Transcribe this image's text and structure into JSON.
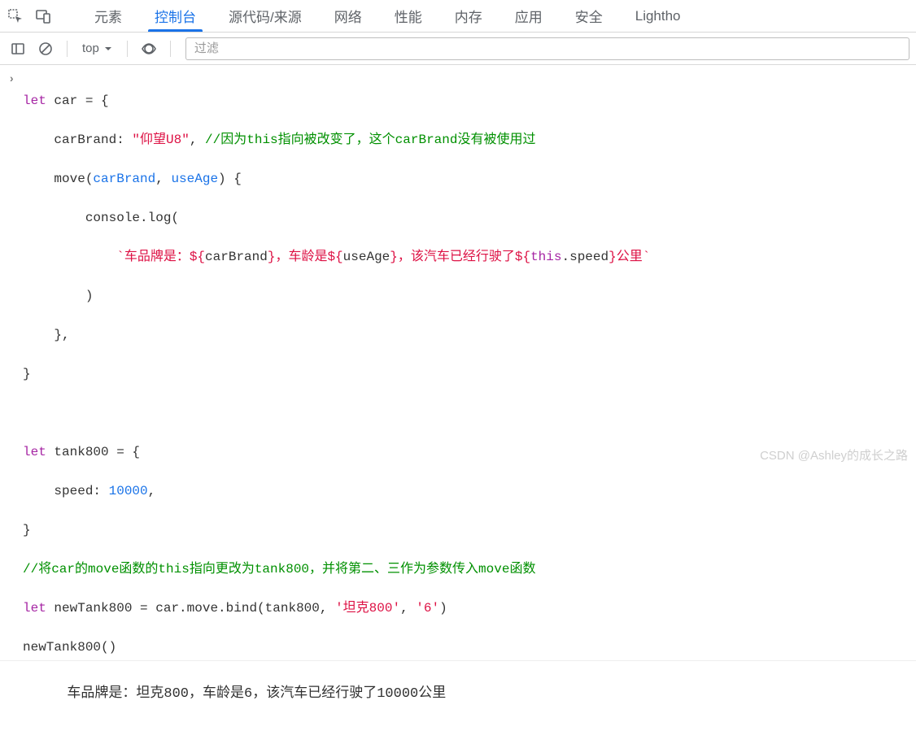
{
  "tabs": {
    "items": [
      {
        "label": "元素"
      },
      {
        "label": "控制台"
      },
      {
        "label": "源代码/来源"
      },
      {
        "label": "网络"
      },
      {
        "label": "性能"
      },
      {
        "label": "内存"
      },
      {
        "label": "应用"
      },
      {
        "label": "安全"
      },
      {
        "label": "Lightho"
      }
    ],
    "activeIndex": 1
  },
  "toolbar": {
    "context": "top",
    "filter_placeholder": "过滤"
  },
  "console": {
    "input_code": {
      "l1_kw": "let",
      "l1_rest": " car = {",
      "l2_prop": "    carBrand: ",
      "l2_str": "\"仰望U8\"",
      "l2_comma": ", ",
      "l2_comment": "//因为this指向被改变了，这个carBrand没有被使用过",
      "l3_pre": "    move(",
      "l3_arg1": "carBrand",
      "l3_sep": ", ",
      "l3_arg2": "useAge",
      "l3_post": ") {",
      "l4": "        console.log(",
      "l5_pad": "            ",
      "l5_t1": "`车品牌是：${",
      "l5_v1": "carBrand",
      "l5_t2": "}，车龄是${",
      "l5_v2": "useAge",
      "l5_t3": "}，该汽车已经行驶了${",
      "l5_kw": "this",
      "l5_v3": ".speed",
      "l5_t4": "}公里`",
      "l6": "        )",
      "l7": "    },",
      "l8": "}",
      "blank": "",
      "l9_kw": "let",
      "l9_rest": " tank800 = {",
      "l10_pre": "    speed: ",
      "l10_num": "10000",
      "l10_post": ",",
      "l11": "}",
      "l12_comment": "//将car的move函数的this指向更改为tank800，并将第二、三作为参数传入move函数",
      "l13_kw": "let",
      "l13_rest": " newTank800 = car.move.bind(tank800, ",
      "l13_s1": "'坦克800'",
      "l13_sep": ", ",
      "l13_s2": "'6'",
      "l13_end": ")",
      "l14": "newTank800()"
    },
    "output": "车品牌是：坦克800，车龄是6，该汽车已经行驶了10000公里"
  },
  "watermark": "CSDN @Ashley的成长之路"
}
